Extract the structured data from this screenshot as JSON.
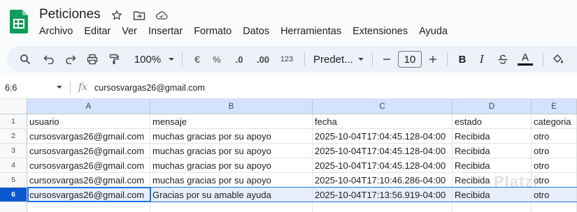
{
  "title_bar": {
    "doc_title": "Peticiones",
    "icons": [
      "star-icon",
      "move-folder-icon",
      "cloud-status-icon"
    ]
  },
  "menu": {
    "items": [
      "Archivo",
      "Editar",
      "Ver",
      "Insertar",
      "Formato",
      "Datos",
      "Herramientas",
      "Extensiones",
      "Ayuda"
    ]
  },
  "toolbar": {
    "zoom": "100%",
    "currency": "€",
    "percent": "%",
    "decrease_decimals": ".0",
    "increase_decimals": ".00",
    "more_formats": "123",
    "font_family": "Predet...",
    "font_size": "10",
    "bold": "B",
    "italic": "I",
    "text_color": "A",
    "text_color_swatch": "#000000"
  },
  "formula_bar": {
    "name_box": "6:6",
    "fx": "fx",
    "value": "cursosvargas26@gmail.com"
  },
  "sheet": {
    "columns": [
      "A",
      "B",
      "C",
      "D",
      "E"
    ],
    "row_numbers": [
      "1",
      "2",
      "3",
      "4",
      "5",
      "6"
    ],
    "selected_row": "6",
    "rows": [
      [
        "usuario",
        "mensaje",
        "fecha",
        "estado",
        "categoria"
      ],
      [
        "cursosvargas26@gmail.com",
        "muchas gracias por su apoyo",
        "2025-10-04T17:04:45.128-04:00",
        "Recibida",
        "otro"
      ],
      [
        "cursosvargas26@gmail.com",
        "muchas gracias por su apoyo",
        "2025-10-04T17:04:45.128-04:00",
        "Recibida",
        "otro"
      ],
      [
        "cursosvargas26@gmail.com",
        "muchas gracias por su apoyo",
        "2025-10-04T17:04:45.128-04:00",
        "Recibida",
        "otro"
      ],
      [
        "cursosvargas26@gmail.com",
        "muchas gracias por su apoyo",
        "2025-10-04T17:10:46.286-04:00",
        "Recibida",
        "otro"
      ],
      [
        "cursosvargas26@gmail.com",
        "Gracias por su amable ayuda",
        "2025-10-04T17:13:56.919-04:00",
        "Recibida",
        "otro"
      ]
    ]
  },
  "colors": {
    "accent": "#0b57d0",
    "selection": "#1a73e8",
    "toolbar_bg": "#edf2fa",
    "sheets_green": "#0f9d58"
  },
  "watermark": "Platzi"
}
